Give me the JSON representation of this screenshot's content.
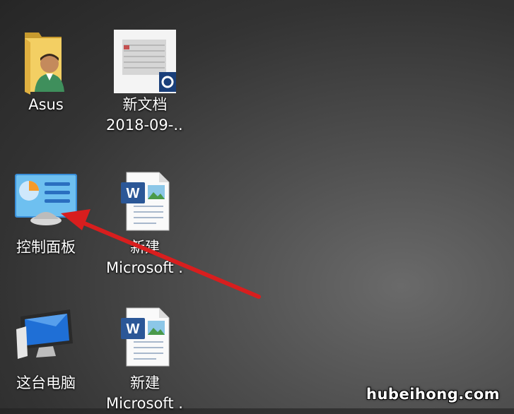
{
  "desktop": {
    "icons": [
      {
        "id": "asus",
        "lines": [
          "Asus"
        ],
        "icon": "user-folder-icon"
      },
      {
        "id": "doc",
        "lines": [
          "新文档",
          "2018-09-..."
        ],
        "icon": "scanned-document-icon"
      },
      {
        "id": "control",
        "lines": [
          "控制面板"
        ],
        "icon": "control-panel-icon"
      },
      {
        "id": "word1",
        "lines": [
          "新建",
          "Microsoft ..."
        ],
        "icon": "word-document-icon"
      },
      {
        "id": "pc",
        "lines": [
          "这台电脑"
        ],
        "icon": "computer-monitor-icon"
      },
      {
        "id": "word2",
        "lines": [
          "新建",
          "Microsoft ..."
        ],
        "icon": "word-document-icon"
      }
    ]
  },
  "annotation": {
    "color": "#d81e1e",
    "icon": "red-arrow-pointer"
  },
  "watermark": "hubeihong.com"
}
